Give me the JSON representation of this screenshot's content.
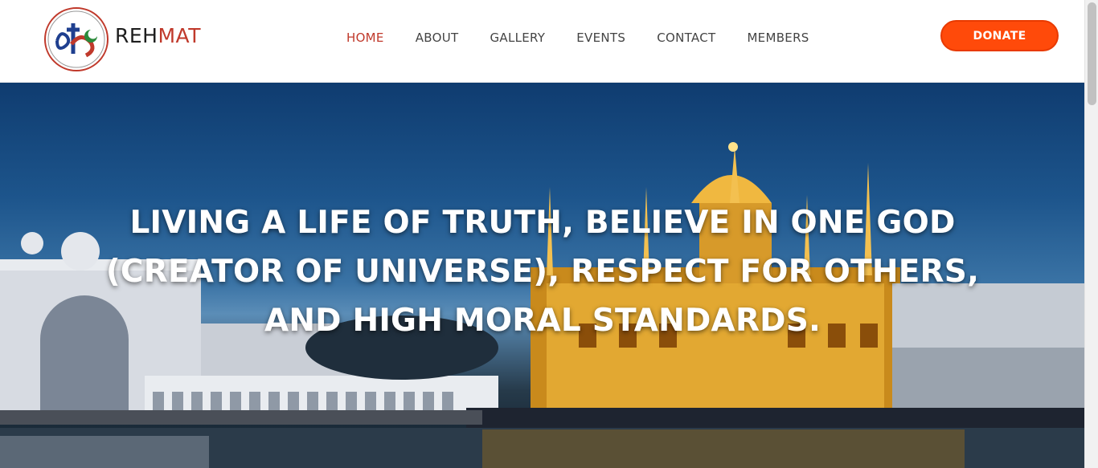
{
  "brand": {
    "part1": "REH",
    "part2": "MAT"
  },
  "nav": {
    "items": [
      {
        "label": "HOME",
        "active": true
      },
      {
        "label": "ABOUT",
        "active": false
      },
      {
        "label": "GALLERY",
        "active": false
      },
      {
        "label": "EVENTS",
        "active": false
      },
      {
        "label": "CONTACT",
        "active": false
      },
      {
        "label": "MEMBERS",
        "active": false
      }
    ]
  },
  "header": {
    "donate_label": "DONATE"
  },
  "hero": {
    "heading": "LIVING A LIFE OF TRUTH, BELIEVE IN ONE GOD (CREATOR OF UNIVERSE), RESPECT FOR OTHERS, AND HIGH MORAL STANDARDS.",
    "image": "golden-temple-photo"
  },
  "colors": {
    "accent": "#c0392b",
    "donate": "#ff4a0a",
    "nav_text": "#444444"
  }
}
